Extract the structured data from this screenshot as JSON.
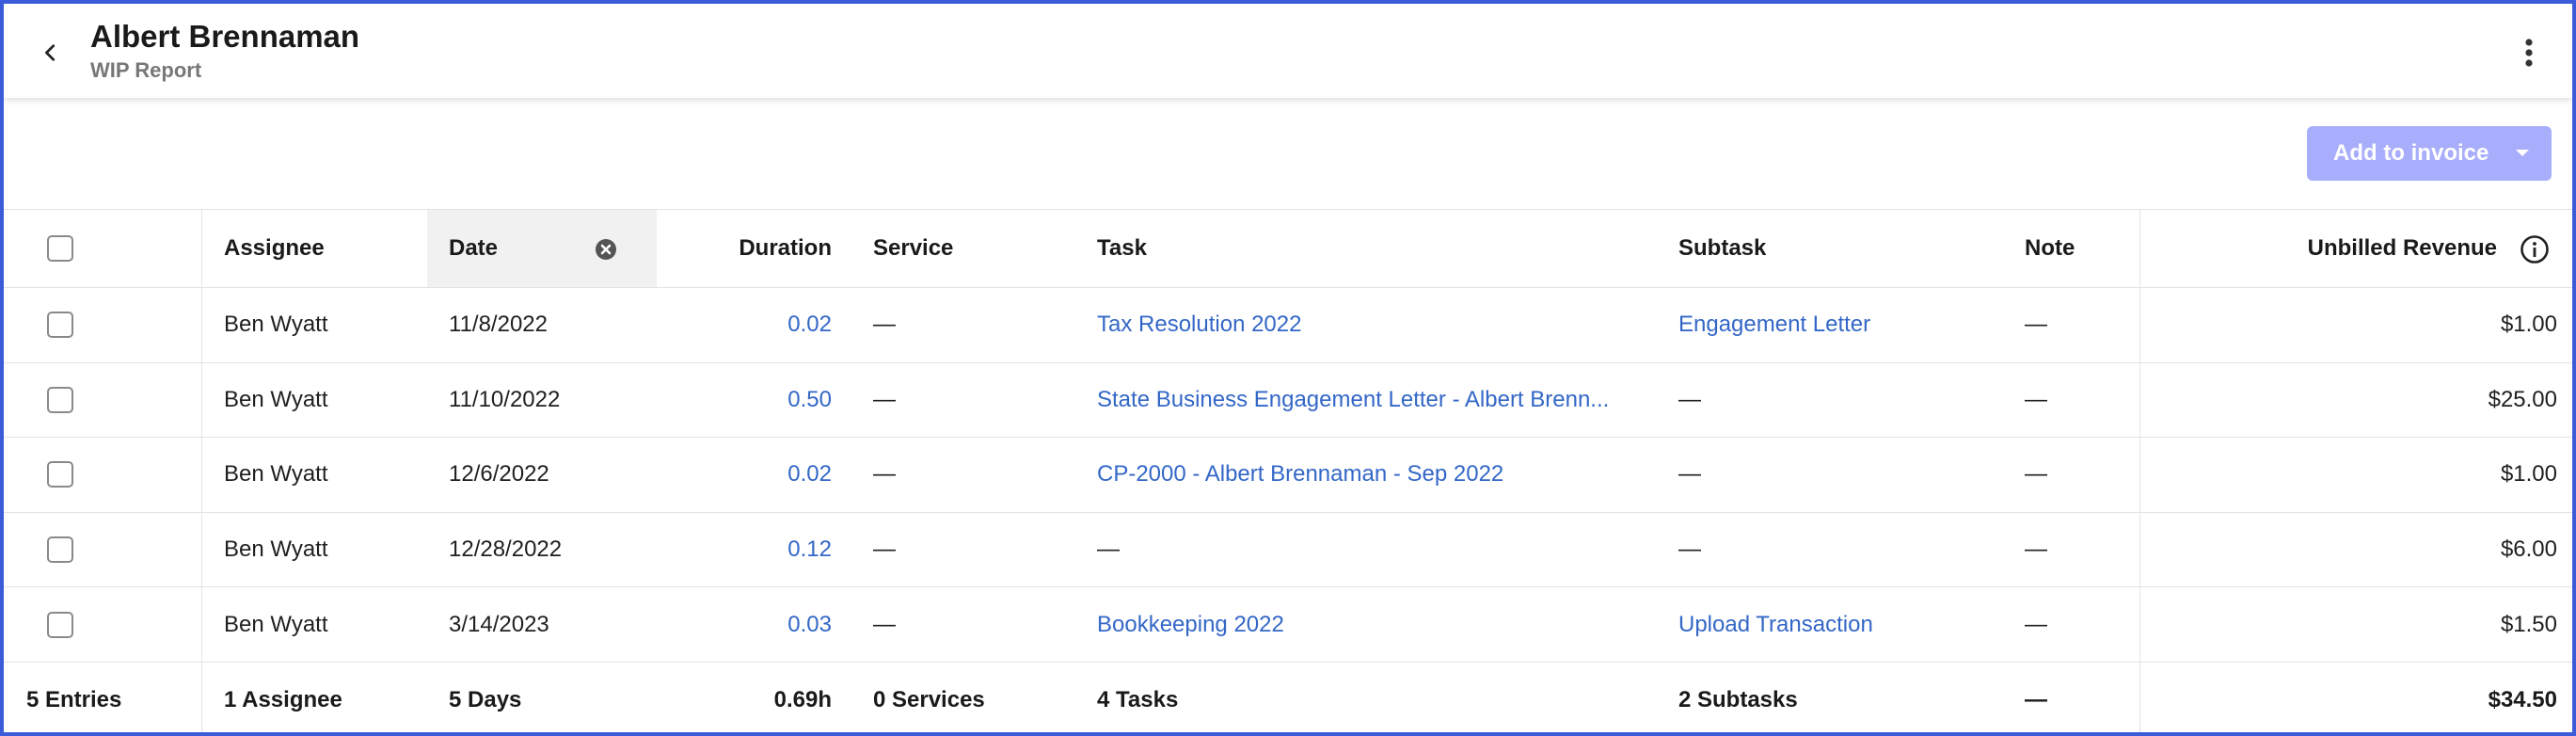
{
  "header": {
    "title": "Albert Brennaman",
    "subtitle": "WIP Report",
    "back_icon": "chevron-left-icon",
    "menu_icon": "more-vertical-icon"
  },
  "toolbar": {
    "add_invoice_label": "Add to invoice",
    "add_invoice_color": "#a9aefc"
  },
  "table": {
    "columns": {
      "assignee": "Assignee",
      "date": "Date",
      "duration": "Duration",
      "service": "Service",
      "task": "Task",
      "subtask": "Subtask",
      "note": "Note",
      "unbilled_revenue": "Unbilled Revenue"
    },
    "rows": [
      {
        "assignee": "Ben Wyatt",
        "date": "11/8/2022",
        "duration": "0.02",
        "service": "—",
        "task": "Tax Resolution 2022",
        "subtask": "Engagement Letter",
        "note": "—",
        "revenue": "$1.00"
      },
      {
        "assignee": "Ben Wyatt",
        "date": "11/10/2022",
        "duration": "0.50",
        "service": "—",
        "task": "State Business Engagement Letter - Albert Brenn...",
        "subtask": "—",
        "note": "—",
        "revenue": "$25.00"
      },
      {
        "assignee": "Ben Wyatt",
        "date": "12/6/2022",
        "duration": "0.02",
        "service": "—",
        "task": "CP-2000 - Albert Brennaman - Sep 2022",
        "subtask": "—",
        "note": "—",
        "revenue": "$1.00"
      },
      {
        "assignee": "Ben Wyatt",
        "date": "12/28/2022",
        "duration": "0.12",
        "service": "—",
        "task": "—",
        "subtask": "—",
        "note": "—",
        "revenue": "$6.00"
      },
      {
        "assignee": "Ben Wyatt",
        "date": "3/14/2023",
        "duration": "0.03",
        "service": "—",
        "task": "Bookkeeping 2022",
        "subtask": "Upload Transaction",
        "note": "—",
        "revenue": "$1.50"
      }
    ],
    "footer": {
      "entries": "5 Entries",
      "assignees": "1 Assignee",
      "days": "5 Days",
      "duration": "0.69h",
      "services": "0 Services",
      "tasks": "4 Tasks",
      "subtasks": "2 Subtasks",
      "note": "—",
      "revenue": "$34.50"
    }
  },
  "colors": {
    "link": "#3367c7",
    "border": "#3b5bdb"
  }
}
